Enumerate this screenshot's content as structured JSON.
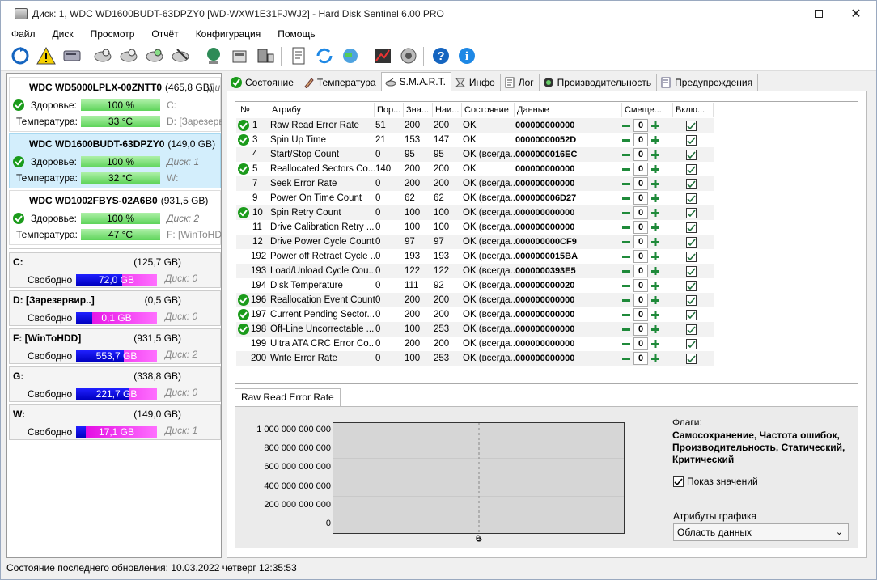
{
  "window": {
    "title": "Диск: 1, WDC WD1600BUDT-63DPZY0 [WD-WXW1E31FJWJ2]  -  Hard Disk Sentinel 6.00 PRO"
  },
  "menu": [
    "Файл",
    "Диск",
    "Просмотр",
    "Отчёт",
    "Конфигурация",
    "Помощь"
  ],
  "disks": [
    {
      "name": "WDC WD5000LPLX-00ZNTT0",
      "size": "(465,8 GB)",
      "side_top": "Ди",
      "health_label": "Здоровье:",
      "health": "100 %",
      "health_side": "C:",
      "temp_label": "Температура:",
      "temp": "33 °C",
      "temp_side": "D: [Зарезерв",
      "selected": false
    },
    {
      "name": "WDC WD1600BUDT-63DPZY0",
      "size": "(149,0 GB)",
      "side_top": "",
      "health_label": "Здоровье:",
      "health": "100 %",
      "health_side": "Диск: 1",
      "temp_label": "Температура:",
      "temp": "32 °C",
      "temp_side": "W:",
      "selected": true
    },
    {
      "name": "WDC WD1002FBYS-02A6B0",
      "size": "(931,5 GB)",
      "side_top": "",
      "health_label": "Здоровье:",
      "health": "100 %",
      "health_side": "Диск: 2",
      "temp_label": "Температура:",
      "temp": "47 °C",
      "temp_side": "F: [WinToHD",
      "selected": false
    }
  ],
  "volumes": [
    {
      "name": "C:",
      "size": "(125,7 GB)",
      "free_label": "Свободно",
      "free": "72,0 GB",
      "free_fraction": 0.573,
      "disk": "Диск: 0"
    },
    {
      "name": "D: [Зарезервир..]",
      "size": "(0,5 GB)",
      "free_label": "Свободно",
      "free": "0,1 GB",
      "free_fraction": 0.2,
      "disk": "Диск: 0"
    },
    {
      "name": "F: [WinToHDD]",
      "size": "(931,5 GB)",
      "free_label": "Свободно",
      "free": "553,7 GB",
      "free_fraction": 0.594,
      "disk": "Диск: 2"
    },
    {
      "name": "G:",
      "size": "(338,8 GB)",
      "free_label": "Свободно",
      "free": "221,7 GB",
      "free_fraction": 0.654,
      "disk": "Диск: 0"
    },
    {
      "name": "W:",
      "size": "(149,0 GB)",
      "free_label": "Свободно",
      "free": "17,1 GB",
      "free_fraction": 0.115,
      "disk": "Диск: 1"
    }
  ],
  "tabs": [
    "Состояние",
    "Температура",
    "S.M.A.R.T.",
    "Инфо",
    "Лог",
    "Производительность",
    "Предупреждения"
  ],
  "columns": [
    "№",
    "Атрибут",
    "Пор...",
    "Зна...",
    "Наи...",
    "Состояние",
    "Данные",
    "Смеще...",
    "Вклю..."
  ],
  "rows": [
    {
      "ok": true,
      "no": "1",
      "attr": "Raw Read Error Rate",
      "thr": "51",
      "val": "200",
      "worst": "200",
      "state": "OK",
      "data": "000000000000",
      "offset": "0"
    },
    {
      "ok": true,
      "no": "3",
      "attr": "Spin Up Time",
      "thr": "21",
      "val": "153",
      "worst": "147",
      "state": "OK",
      "data": "00000000052D",
      "offset": "0"
    },
    {
      "ok": false,
      "no": "4",
      "attr": "Start/Stop Count",
      "thr": "0",
      "val": "95",
      "worst": "95",
      "state": "OK (всегда...",
      "data": "0000000016EC",
      "offset": "0"
    },
    {
      "ok": true,
      "no": "5",
      "attr": "Reallocated Sectors Co...",
      "thr": "140",
      "val": "200",
      "worst": "200",
      "state": "OK",
      "data": "000000000000",
      "offset": "0"
    },
    {
      "ok": false,
      "no": "7",
      "attr": "Seek Error Rate",
      "thr": "0",
      "val": "200",
      "worst": "200",
      "state": "OK (всегда...",
      "data": "000000000000",
      "offset": "0"
    },
    {
      "ok": false,
      "no": "9",
      "attr": "Power On Time Count",
      "thr": "0",
      "val": "62",
      "worst": "62",
      "state": "OK (всегда...",
      "data": "000000006D27",
      "offset": "0"
    },
    {
      "ok": true,
      "no": "10",
      "attr": "Spin Retry Count",
      "thr": "0",
      "val": "100",
      "worst": "100",
      "state": "OK (всегда...",
      "data": "000000000000",
      "offset": "0"
    },
    {
      "ok": false,
      "no": "11",
      "attr": "Drive Calibration Retry ...",
      "thr": "0",
      "val": "100",
      "worst": "100",
      "state": "OK (всегда...",
      "data": "000000000000",
      "offset": "0"
    },
    {
      "ok": false,
      "no": "12",
      "attr": "Drive Power Cycle Count",
      "thr": "0",
      "val": "97",
      "worst": "97",
      "state": "OK (всегда...",
      "data": "000000000CF9",
      "offset": "0"
    },
    {
      "ok": false,
      "no": "192",
      "attr": "Power off Retract Cycle ...",
      "thr": "0",
      "val": "193",
      "worst": "193",
      "state": "OK (всегда...",
      "data": "0000000015BA",
      "offset": "0"
    },
    {
      "ok": false,
      "no": "193",
      "attr": "Load/Unload Cycle Cou...",
      "thr": "0",
      "val": "122",
      "worst": "122",
      "state": "OK (всегда...",
      "data": "0000000393E5",
      "offset": "0"
    },
    {
      "ok": false,
      "no": "194",
      "attr": "Disk Temperature",
      "thr": "0",
      "val": "111",
      "worst": "92",
      "state": "OK (всегда...",
      "data": "000000000020",
      "offset": "0"
    },
    {
      "ok": true,
      "no": "196",
      "attr": "Reallocation Event Count",
      "thr": "0",
      "val": "200",
      "worst": "200",
      "state": "OK (всегда...",
      "data": "000000000000",
      "offset": "0"
    },
    {
      "ok": true,
      "no": "197",
      "attr": "Current Pending Sector...",
      "thr": "0",
      "val": "200",
      "worst": "200",
      "state": "OK (всегда...",
      "data": "000000000000",
      "offset": "0"
    },
    {
      "ok": true,
      "no": "198",
      "attr": "Off-Line Uncorrectable ...",
      "thr": "0",
      "val": "100",
      "worst": "253",
      "state": "OK (всегда...",
      "data": "000000000000",
      "offset": "0"
    },
    {
      "ok": false,
      "no": "199",
      "attr": "Ultra ATA CRC Error Co...",
      "thr": "0",
      "val": "200",
      "worst": "200",
      "state": "OK (всегда...",
      "data": "000000000000",
      "offset": "0"
    },
    {
      "ok": false,
      "no": "200",
      "attr": "Write Error Rate",
      "thr": "0",
      "val": "100",
      "worst": "253",
      "state": "OK (всегда...",
      "data": "000000000000",
      "offset": "0"
    }
  ],
  "chart": {
    "tab": "Raw Read Error Rate",
    "y_ticks": [
      "1 000 000 000 000",
      "800 000 000 000",
      "600 000 000 000",
      "400 000 000 000",
      "200 000 000 000",
      "0"
    ],
    "x_tick": "0"
  },
  "chart_data": {
    "type": "line",
    "title": "Raw Read Error Rate",
    "ylim": [
      0,
      1000000000000
    ],
    "x": [
      "0"
    ],
    "series": [
      {
        "values": [
          0
        ]
      }
    ],
    "grid": true
  },
  "flags": {
    "label": "Флаги:",
    "value": "Самосохранение, Частота ошибок, Производительность, Статический, Критический"
  },
  "show_values": {
    "label": "Показ значений",
    "checked": true
  },
  "graph_attrs": {
    "label": "Атрибуты графика",
    "selected": "Область данных"
  },
  "status": "Состояние последнего обновления: 10.03.2022 четверг 12:35:53",
  "colors": {
    "health_green": "#5ed45a",
    "ok_green": "#1b9b1b",
    "used_magenta": "#e000e0",
    "free_blue": "#0000c0"
  }
}
